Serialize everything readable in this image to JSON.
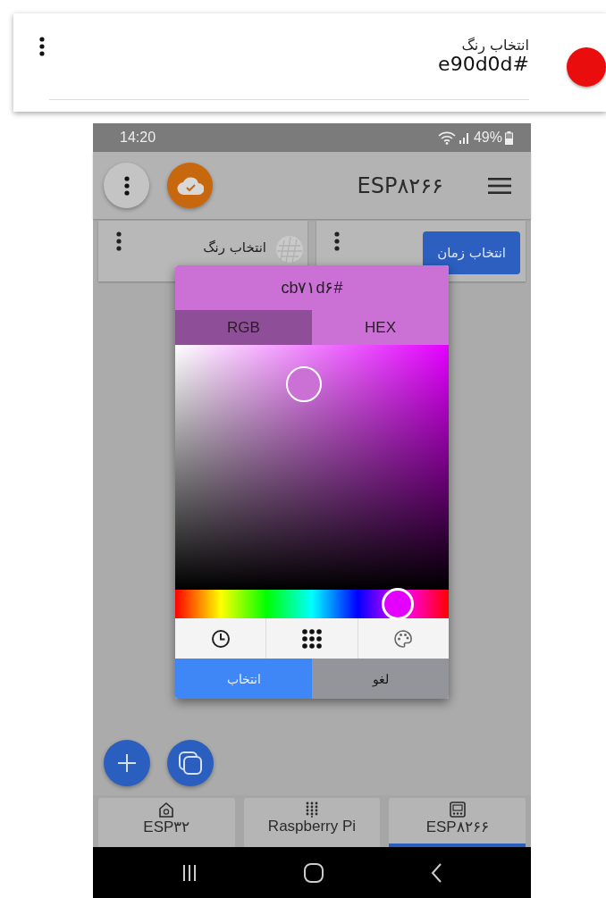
{
  "top_card": {
    "title": "انتخاب رنگ",
    "value": "e90d0d#",
    "color": "#e90d0d"
  },
  "phone": {
    "status_bar": {
      "time": "14:20",
      "battery": "49%"
    },
    "app_bar": {
      "title": "ESP۸۲۶۶"
    },
    "widgets": [
      {
        "kind": "button",
        "label": "انتخاب زمان"
      },
      {
        "kind": "color",
        "title": "انتخاب رنگ"
      }
    ],
    "color_dialog": {
      "value": "cb۷۱d۶#",
      "tabs": [
        {
          "label": "HEX",
          "selected": true
        },
        {
          "label": "RGB",
          "selected": false
        }
      ],
      "buttons": [
        {
          "kind": "cancel",
          "label": "لغو"
        },
        {
          "kind": "primary",
          "label": "انتخاب"
        }
      ]
    },
    "device_tabs": [
      {
        "label": "ESP۸۲۶۶",
        "selected": true
      },
      {
        "label": "Raspberry Pi",
        "selected": false
      },
      {
        "label": "ESP۳۲",
        "selected": false
      }
    ]
  }
}
